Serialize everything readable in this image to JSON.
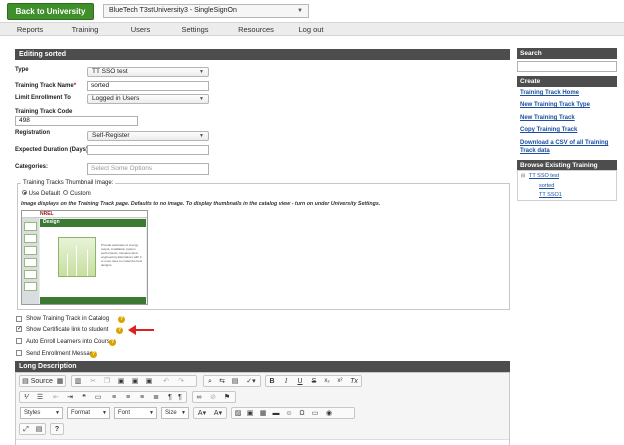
{
  "header": {
    "back_label": "Back to University",
    "university_select": "BlueTech T3stUniversity3 - SingleSignOn"
  },
  "nav": {
    "items": [
      "Reports",
      "Training",
      "Users",
      "Settings",
      "Resources",
      "Log out"
    ]
  },
  "form": {
    "section_title": "Editing sorted",
    "type_label": "Type",
    "type_value": "TT SSO test",
    "name_label": "Training Track Name",
    "name_value": "sorted",
    "limit_label": "Limit Enrollment To",
    "limit_value": "Logged in Users",
    "code_label": "Training Track Code",
    "code_value": "498",
    "registration_label": "Registration",
    "registration_value": "Self-Register",
    "duration_label": "Expected Duration (Days):",
    "duration_value": "",
    "categories_label": "Categories:",
    "categories_placeholder": "Select Some Options",
    "thumb_legend": "Training Tracks Thumbnail Image:",
    "use_default_label": "Use Default",
    "custom_label": "Custom",
    "thumb_note": "Image displays on the Training Track page. Defaults to no image. To display thumbnails in the catalog view - turn on under University Settings.",
    "show_catalog_label": "Show Training Track in Catalog",
    "show_certificate_label": "Show Certificate link to student",
    "auto_enroll_label": "Auto Enroll Learners into Courses",
    "send_message_label": "Send Enrollment Message",
    "long_desc_title": "Long Description",
    "show_catalog_checked": false,
    "show_certificate_checked": true,
    "auto_enroll_checked": false,
    "send_message_checked": false
  },
  "thumbnail": {
    "brand": "NREL",
    "page_title": "Design",
    "body_text": "Provide estimates of energy output, installation system performance. Develop wind engineering alternatives with 2 or more sites to model the best designs."
  },
  "editor": {
    "source_label": "Source",
    "styles_label": "Styles",
    "format_label": "Format",
    "font_label": "Font",
    "size_label": "Size",
    "help_glyph": "?"
  },
  "sidebar": {
    "search_title": "Search",
    "create_title": "Create",
    "links": [
      "Training Track Home",
      "New Training Track Type",
      "New Training Track",
      "Copy Training Track",
      "Download a CSV of all Training Track data"
    ],
    "browse_title": "Browse Existing Training Tracks",
    "tree_root": "TT SSO test",
    "tree_children": [
      "sorted",
      "TT SSO1"
    ]
  },
  "colors": {
    "accent_green": "#3f8f2a",
    "section_header": "#4d4d4d",
    "link_blue": "#1a4fa0",
    "annotation_arrow": "#e02020"
  }
}
